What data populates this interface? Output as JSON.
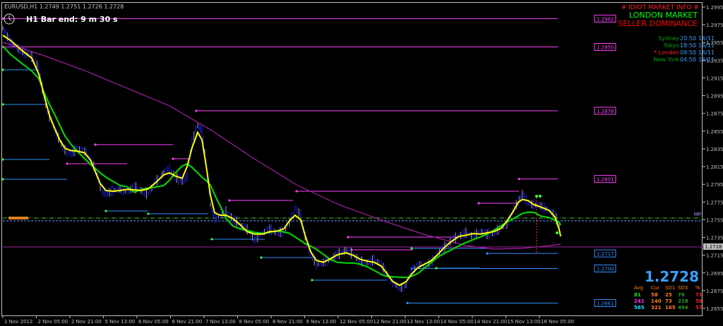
{
  "header": {
    "symbol_info": "EURUSD,H1  1.2749 1.2751 1.2726 1.2728",
    "bar_end": "H1 Bar end: 9 m 30 s"
  },
  "market_info": {
    "title": "# IDIOT MARKET INFO #",
    "market": "LONDON MARKET",
    "dominance": "SELLER DOMINANCE",
    "sessions": [
      {
        "name": "Sydney",
        "time": "20:50",
        "date": "16/11",
        "color": "#00a000"
      },
      {
        "name": "Tokyo",
        "time": "18:50",
        "date": "16/11",
        "color": "#00a000"
      },
      {
        "name": "* London",
        "time": "09:50",
        "date": "16/11",
        "color": "#ff2020"
      },
      {
        "name": "New York",
        "time": "04:50",
        "date": "16/11",
        "color": "#00a000"
      }
    ]
  },
  "price_box": {
    "price": "1.2728",
    "headers": [
      "Avg",
      "Cur",
      "SD1",
      "SD3",
      "%"
    ],
    "rows": [
      {
        "values": [
          "81",
          "58",
          "25",
          "76",
          "71"
        ],
        "colors": [
          "#20e020",
          "#ff8020",
          "#ff8020",
          "#20a020",
          "#ff2020"
        ]
      },
      {
        "values": [
          "241",
          "140",
          "73",
          "218",
          "58"
        ],
        "colors": [
          "#ff30ff",
          "#ff8020",
          "#ff8020",
          "#20a020",
          "#ff2020"
        ]
      },
      {
        "values": [
          "565",
          "321",
          "165",
          "494",
          "57"
        ],
        "colors": [
          "#20e0ff",
          "#ff8020",
          "#ff8020",
          "#20a020",
          "#ff2020"
        ]
      }
    ]
  },
  "level_labels": [
    {
      "label": "1.2982",
      "price": 1.2982,
      "color": "#ff40ff"
    },
    {
      "label": "1.2950",
      "price": 1.295,
      "color": "#ff40ff"
    },
    {
      "label": "1.2878",
      "price": 1.2878,
      "color": "#ff40ff"
    },
    {
      "label": "1.2801",
      "price": 1.2801,
      "color": "#ff40ff"
    },
    {
      "label": "1.2717",
      "price": 1.2717,
      "color": "#3090ff"
    },
    {
      "label": "1.2700",
      "price": 1.27,
      "color": "#3090ff"
    },
    {
      "label": "1.2661",
      "price": 1.2661,
      "color": "#3090ff"
    }
  ],
  "mp_label": "MP",
  "current_price_tag": "1.2728",
  "price_axis": [
    "1.2995",
    "1.2975",
    "1.2955",
    "1.2935",
    "1.2915",
    "1.2895",
    "1.2875",
    "1.2855",
    "1.2835",
    "1.2815",
    "1.2795",
    "1.2775",
    "1.2755",
    "1.2735",
    "1.2715",
    "1.2695",
    "1.2675",
    "1.2655"
  ],
  "time_axis": [
    "1 Nov 2012",
    "2 Nov 05:00",
    "2 Nov 21:00",
    "5 Nov 13:00",
    "6 Nov 05:00",
    "6 Nov 21:00",
    "7 Nov 13:00",
    "8 Nov 05:00",
    "8 Nov 21:00",
    "9 Nov 13:00",
    "12 Nov 05:00",
    "12 Nov 21:00",
    "13 Nov 13:00",
    "14 Nov 05:00",
    "14 Nov 21:00",
    "15 Nov 13:00",
    "16 Nov 05:00"
  ],
  "colors": {
    "background": "#000000",
    "candles": "#2020ff",
    "fast_ma": "#ffff00",
    "slow_ma": "#00e000",
    "long_ma": "#a020a0",
    "resistance": "#ff40ff",
    "support": "#3090ff"
  }
}
